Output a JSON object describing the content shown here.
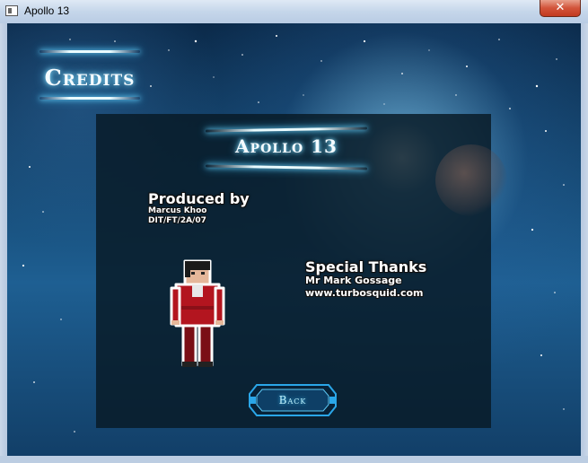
{
  "window": {
    "title": "Apollo 13",
    "close_glyph": "✕"
  },
  "screen": {
    "heading": "Credits",
    "panel": {
      "game_title": "Apollo 13",
      "produced": {
        "heading": "Produced by",
        "lines": [
          "Marcus Khoo",
          "DIT/FT/2A/07"
        ]
      },
      "thanks": {
        "heading": "Special Thanks",
        "lines": [
          "Mr Mark Gossage",
          "www.turbosquid.com"
        ]
      },
      "back_button": "Back"
    }
  },
  "colors": {
    "glow": "#8fe3ff",
    "panel_bg": "#081a26",
    "button_accent": "#2aa6e8",
    "character_shirt": "#b3151f"
  },
  "icons": {
    "window_icon": "app-window-icon",
    "close": "close-icon"
  }
}
